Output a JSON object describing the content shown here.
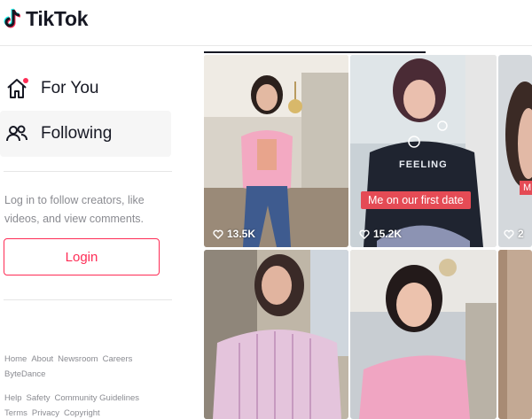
{
  "header": {
    "brand": "TikTok"
  },
  "sidebar": {
    "nav": [
      {
        "label": "For You",
        "icon": "home-icon"
      },
      {
        "label": "Following",
        "icon": "people-icon"
      }
    ],
    "promo_text": "Log in to follow creators, like videos, and view comments.",
    "login_label": "Login",
    "footer_row1": [
      "Home",
      "About",
      "Newsroom",
      "Careers",
      "ByteDance"
    ],
    "footer_row2": [
      "Help",
      "Safety",
      "Community Guidelines"
    ],
    "footer_row3": [
      "Terms",
      "Privacy",
      "Copyright"
    ]
  },
  "videos": [
    {
      "views": "13.5K"
    },
    {
      "views": "15.2K",
      "caption": "Me on our first date",
      "shirt_text": "FEELING"
    },
    {
      "views": "2",
      "caption": "M"
    },
    {
      "views": ""
    },
    {
      "views": ""
    },
    {
      "views": ""
    }
  ],
  "colors": {
    "brand": "#fe2c55",
    "text": "#161823",
    "muted": "#8a8b91"
  }
}
